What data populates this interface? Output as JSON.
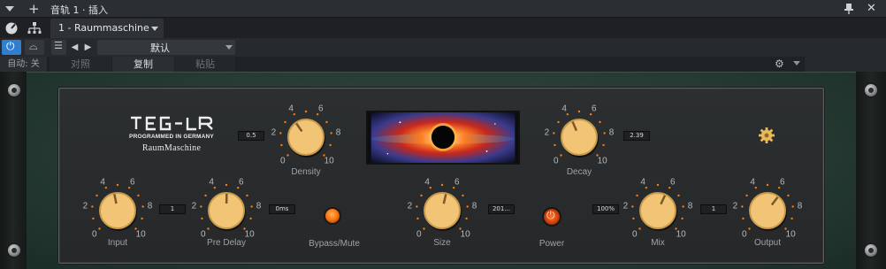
{
  "window": {
    "title": "音轨 1 · 插入",
    "preset_tab": "1 - Raummaschine"
  },
  "controls": {
    "preset_name": "默认",
    "automation_label": "自动: 关",
    "compare_label": "对照",
    "copy_label": "复制",
    "paste_label": "粘贴"
  },
  "plugin": {
    "brand": "TEGELER",
    "brand_sub": "PROGRAMMED IN GERMANY",
    "product": "RaumMaschine",
    "accent_color": "#f2c476",
    "led_color": "#ff7a10",
    "panel_color": "#2f473f",
    "knobs": [
      {
        "name": "density",
        "label": "Density",
        "value": "0.5",
        "scale": [
          "0",
          "2",
          "4",
          "6",
          "8",
          "10"
        ]
      },
      {
        "name": "decay",
        "label": "Decay",
        "value": "2.39",
        "scale": [
          "0",
          "2",
          "4",
          "6",
          "8",
          "10"
        ]
      },
      {
        "name": "input",
        "label": "Input",
        "value": "1",
        "scale": [
          "0",
          "2",
          "4",
          "6",
          "8",
          "10"
        ]
      },
      {
        "name": "pre-delay",
        "label": "Pre Delay",
        "value": "0ms",
        "scale": [
          "0",
          "2",
          "4",
          "6",
          "8",
          "10"
        ]
      },
      {
        "name": "size",
        "label": "Size",
        "value": "201...",
        "scale": [
          "0",
          "2",
          "4",
          "6",
          "8",
          "10"
        ]
      },
      {
        "name": "mix",
        "label": "Mix",
        "value": "100%",
        "scale": [
          "0",
          "2",
          "4",
          "6",
          "8",
          "10"
        ]
      },
      {
        "name": "output",
        "label": "Output",
        "value": "1",
        "scale": [
          "0",
          "2",
          "4",
          "6",
          "8",
          "10"
        ]
      }
    ],
    "bypass_label": "Bypass/Mute",
    "power_label": "Power"
  },
  "icons": [
    "menu-arrow-icon",
    "add-icon",
    "pin-icon",
    "close-icon",
    "power-icon",
    "compare-icon",
    "preset-list-icon",
    "gear-icon",
    "screw-icon",
    "black-hole-display"
  ]
}
